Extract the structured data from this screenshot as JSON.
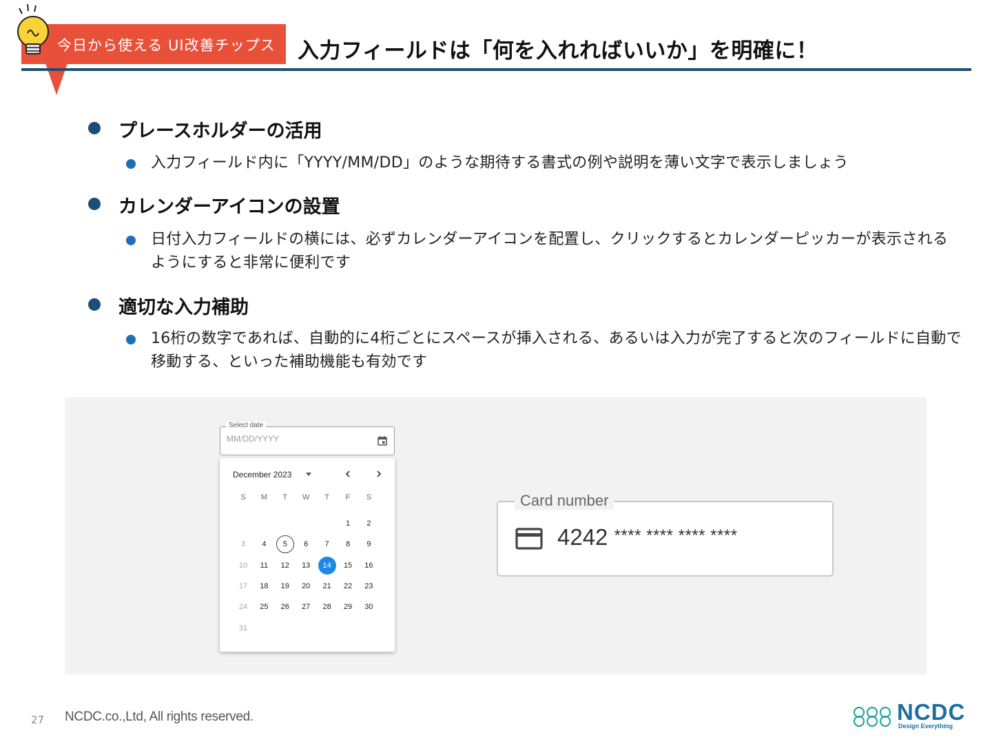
{
  "header": {
    "tag_label": "今日から使える UI改善チップス",
    "title": "入力フィールドは「何を入れればいいか」を明確に！",
    "accent_color": "#e8503a",
    "rule_color": "#1d4e6e",
    "bulb_icon": "lightbulb-icon"
  },
  "sections": [
    {
      "heading": "プレースホルダーの活用",
      "detail": "入力フィールド内に「YYYY/MM/DD」のような期待する書式の例や説明を薄い文字で表示しましょう"
    },
    {
      "heading": "カレンダーアイコンの設置",
      "detail": "日付入力フィールドの横には、必ずカレンダーアイコンを配置し、クリックするとカレンダーピッカーが表示されるようにすると非常に便利です"
    },
    {
      "heading": "適切な入力補助",
      "detail": "16桁の数字であれば、自動的に4桁ごとにスペースが挿入される、あるいは入力が完了すると次のフィールドに自動で移動する、といった補助機能も有効です"
    }
  ],
  "date_picker": {
    "label": "Select date",
    "placeholder": "MM/DD/YYYY",
    "month_label": "December 2023",
    "weekdays": [
      "S",
      "M",
      "T",
      "W",
      "T",
      "F",
      "S"
    ],
    "first_weekday_index": 5,
    "days_in_month": 31,
    "today": 5,
    "selected": 14,
    "past_days": [
      3,
      10,
      17,
      24,
      31
    ],
    "selected_color": "#1e88e5",
    "icons": [
      "calendar-icon",
      "chevron-left-icon",
      "chevron-right-icon",
      "dropdown-arrow-icon"
    ]
  },
  "card_field": {
    "label": "Card number",
    "value_digits": "4242",
    "value_masked": "**** **** **** ****",
    "icon": "credit-card-icon"
  },
  "footer": {
    "page_number": "27",
    "copyright": "NCDC.co.,Ltd, All rights reserved.",
    "logo_text": "NCDC",
    "logo_tagline": "Design Everything",
    "logo_color": "#1b6f9e"
  }
}
